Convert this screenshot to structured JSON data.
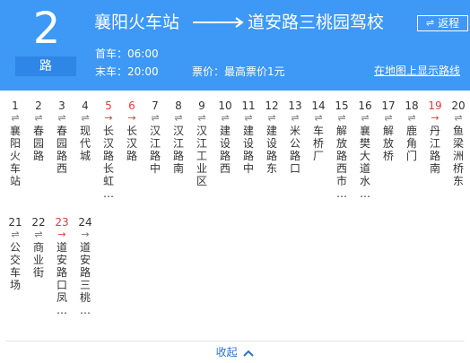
{
  "header": {
    "route_number": "2",
    "route_unit": "路",
    "from_station": "襄阳火车站",
    "to_station": "道安路三桃园驾校",
    "return_button": {
      "icon": "swap-icon",
      "label": "返程"
    },
    "first_bus": "首车：06:00",
    "last_bus": "末车：20:00",
    "fare": "票价：最高票价1元",
    "map_link": "在地图上显示路线"
  },
  "stops": [
    {
      "num": "1",
      "name": "襄阳火车站",
      "dir": "⇌",
      "highlight": false
    },
    {
      "num": "2",
      "name": "春园路",
      "dir": "⇌",
      "highlight": false
    },
    {
      "num": "3",
      "name": "春园路西",
      "dir": "⇌",
      "highlight": false
    },
    {
      "num": "4",
      "name": "现代城",
      "dir": "⇌",
      "highlight": false
    },
    {
      "num": "5",
      "name": "长汉路长虹…",
      "dir": "→",
      "highlight": true
    },
    {
      "num": "6",
      "name": "长汉路",
      "dir": "→",
      "highlight": true
    },
    {
      "num": "7",
      "name": "汉江路中",
      "dir": "⇌",
      "highlight": false
    },
    {
      "num": "8",
      "name": "汉江路南",
      "dir": "⇌",
      "highlight": false
    },
    {
      "num": "9",
      "name": "汉江工业区",
      "dir": "⇌",
      "highlight": false
    },
    {
      "num": "10",
      "name": "建设路西",
      "dir": "⇌",
      "highlight": false
    },
    {
      "num": "11",
      "name": "建设路中",
      "dir": "⇌",
      "highlight": false
    },
    {
      "num": "12",
      "name": "建设路东",
      "dir": "⇌",
      "highlight": false
    },
    {
      "num": "13",
      "name": "米公路口",
      "dir": "⇌",
      "highlight": false
    },
    {
      "num": "14",
      "name": "车桥厂",
      "dir": "⇌",
      "highlight": false
    },
    {
      "num": "15",
      "name": "解放路西市…",
      "dir": "⇌",
      "highlight": false
    },
    {
      "num": "16",
      "name": "襄樊大道水…",
      "dir": "⇌",
      "highlight": false
    },
    {
      "num": "17",
      "name": "解放桥",
      "dir": "⇌",
      "highlight": false
    },
    {
      "num": "18",
      "name": "鹿角门",
      "dir": "⇌",
      "highlight": false
    },
    {
      "num": "19",
      "name": "丹江路南",
      "dir": "→",
      "highlight": true
    },
    {
      "num": "20",
      "name": "鱼梁洲桥东",
      "dir": "⇌",
      "highlight": false
    },
    {
      "num": "21",
      "name": "公交车场",
      "dir": "⇌",
      "highlight": false
    },
    {
      "num": "22",
      "name": "商业街",
      "dir": "⇌",
      "highlight": false
    },
    {
      "num": "23",
      "name": "道安路口凤…",
      "dir": "→",
      "highlight": true
    },
    {
      "num": "24",
      "name": "道安路三桃…",
      "dir": "→",
      "highlight": false
    }
  ],
  "footer": {
    "collapse_label": "收起",
    "collapse_icon": "chevron-up-icon"
  },
  "colors": {
    "header_bg": "#3d98f6",
    "highlight": "#e23b3b",
    "link": "#2b72c9"
  }
}
